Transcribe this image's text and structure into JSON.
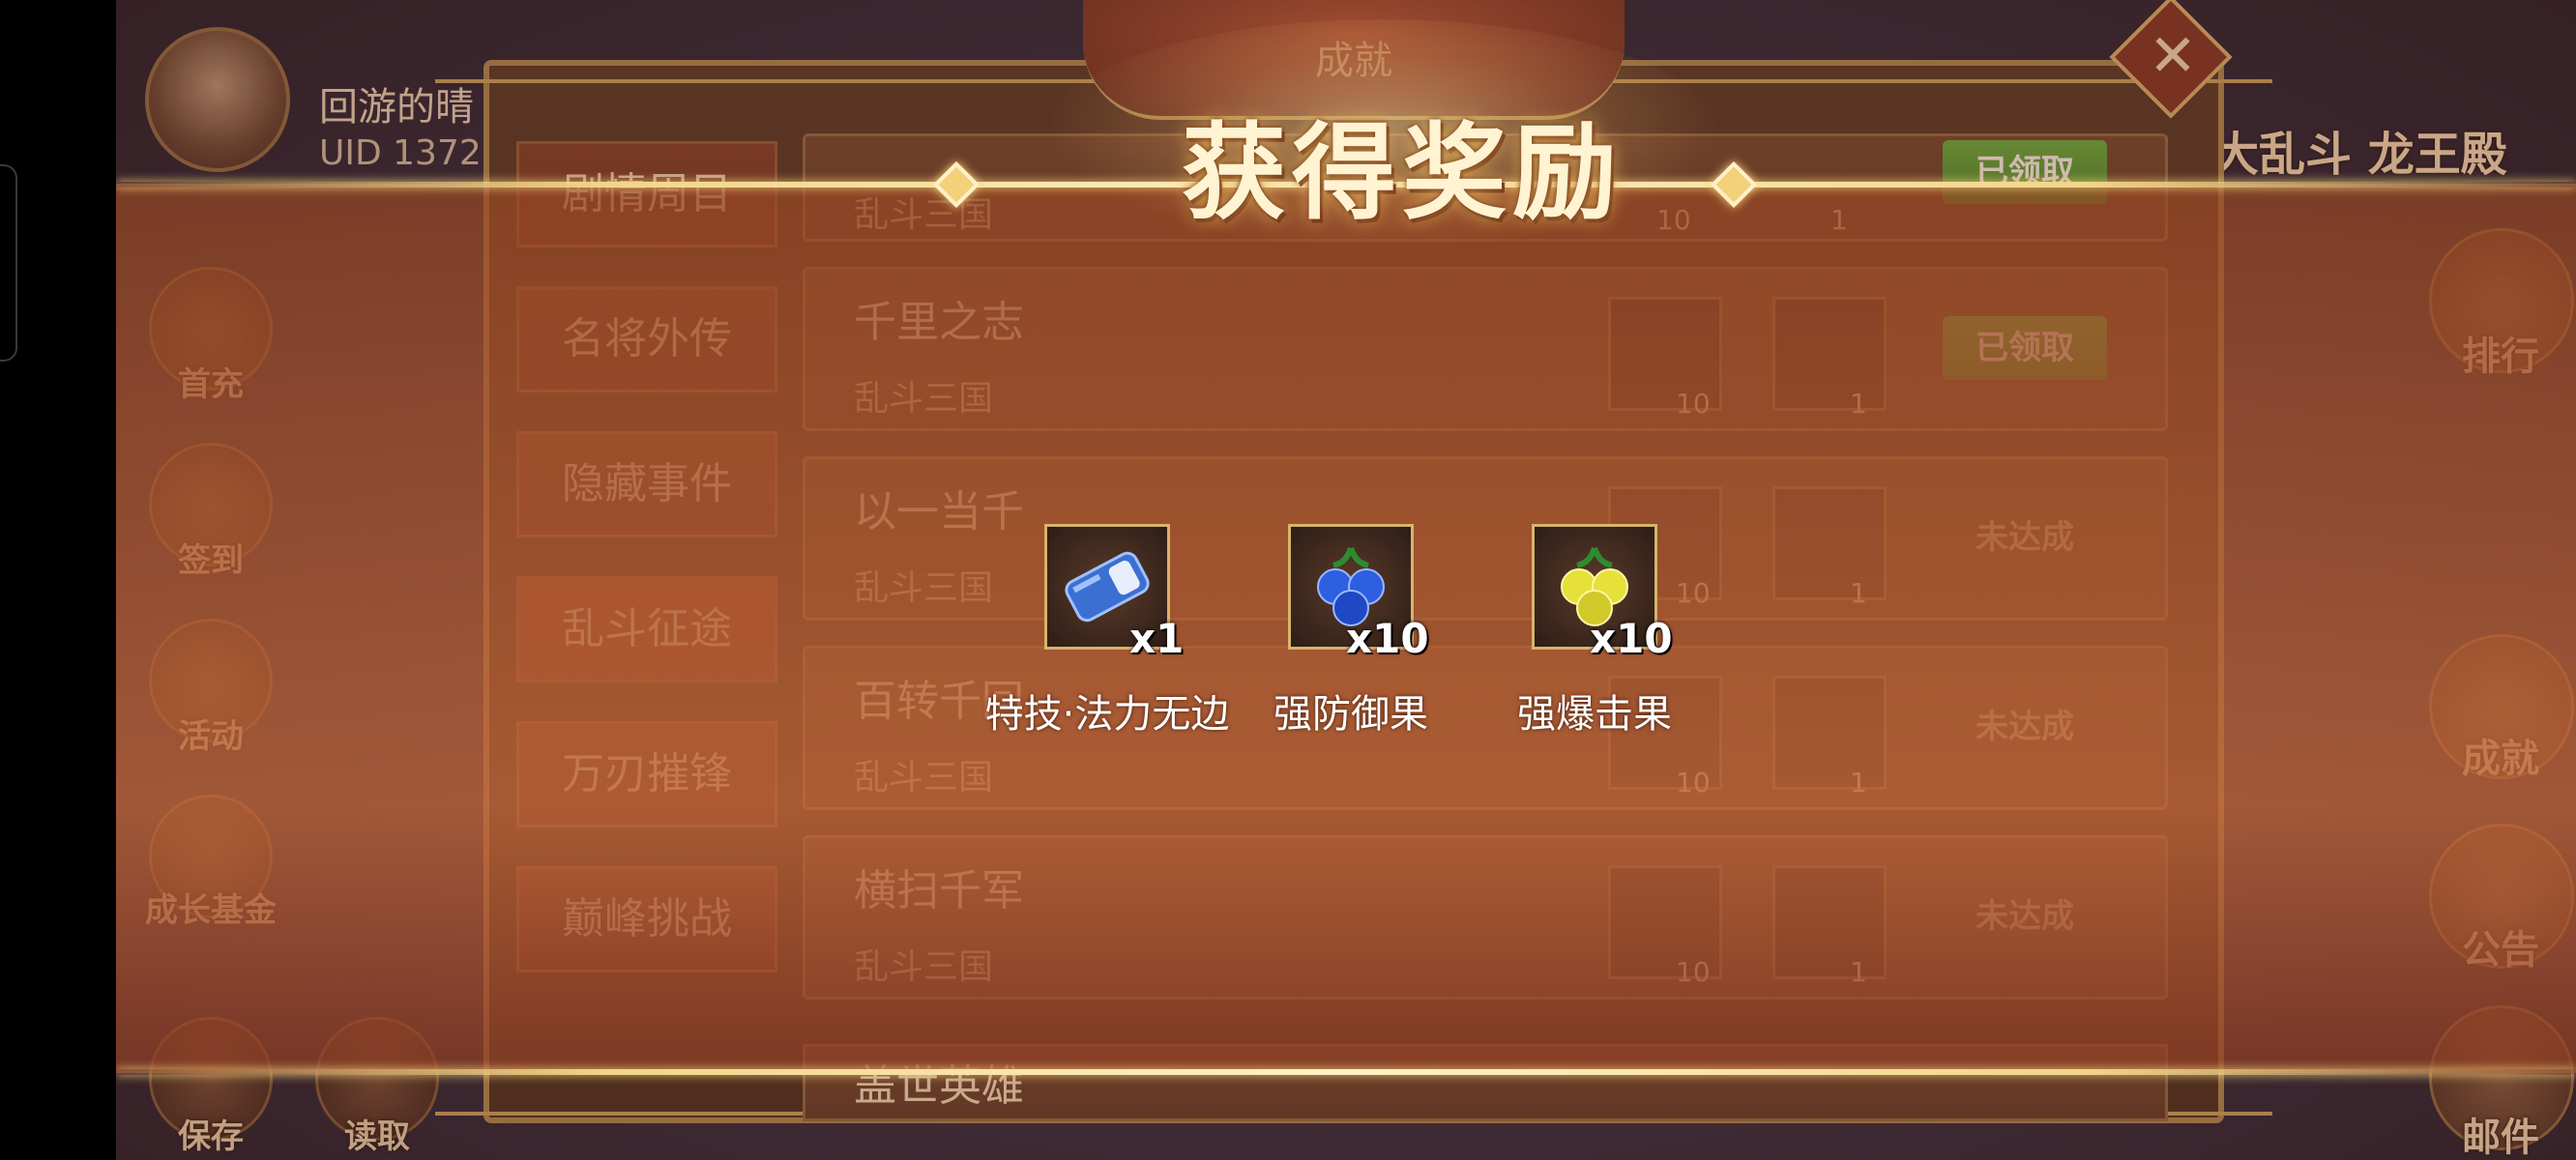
{
  "player": {
    "name": "回游的晴",
    "uid": "UID  1372"
  },
  "left_buttons": [
    "首充",
    "签到",
    "活动",
    "成长基金",
    "保存",
    "读取"
  ],
  "right_buttons": [
    "排行",
    "成就",
    "公告",
    "邮件"
  ],
  "top_right_title": "大乱斗 龙王殿",
  "panel": {
    "header": "成就",
    "close_icon": "✕",
    "tabs": [
      "剧情周目",
      "名将外传",
      "隐藏事件",
      "乱斗征途",
      "万刃摧锋",
      "巅峰挑战"
    ],
    "rows": [
      {
        "title": "",
        "sub": "乱斗三国",
        "counts": [
          "10",
          "1"
        ],
        "status": "已领取"
      },
      {
        "title": "千里之志",
        "sub": "乱斗三国",
        "counts": [
          "10",
          "1"
        ],
        "status": "已领取"
      },
      {
        "title": "以一当千",
        "sub": "乱斗三国",
        "counts": [
          "10",
          "1"
        ],
        "status": "未达成"
      },
      {
        "title": "百转千回",
        "sub": "乱斗三国",
        "counts": [
          "10",
          "1"
        ],
        "status": "未达成"
      },
      {
        "title": "横扫千军",
        "sub": "乱斗三国",
        "counts": [
          "10",
          "1"
        ],
        "status": "未达成"
      }
    ],
    "partial_row_title": "盖世英雄"
  },
  "reward": {
    "title": "获得奖励",
    "items": [
      {
        "name": "特技·法力无边",
        "qty": "x1",
        "icon": "scroll-icon",
        "color": "#3b6fd1"
      },
      {
        "name": "强防御果",
        "qty": "x10",
        "icon": "blue-fruit-icon",
        "color": "#2d5fe0"
      },
      {
        "name": "强爆击果",
        "qty": "x10",
        "icon": "yellow-fruit-icon",
        "color": "#e6e03a"
      }
    ]
  }
}
